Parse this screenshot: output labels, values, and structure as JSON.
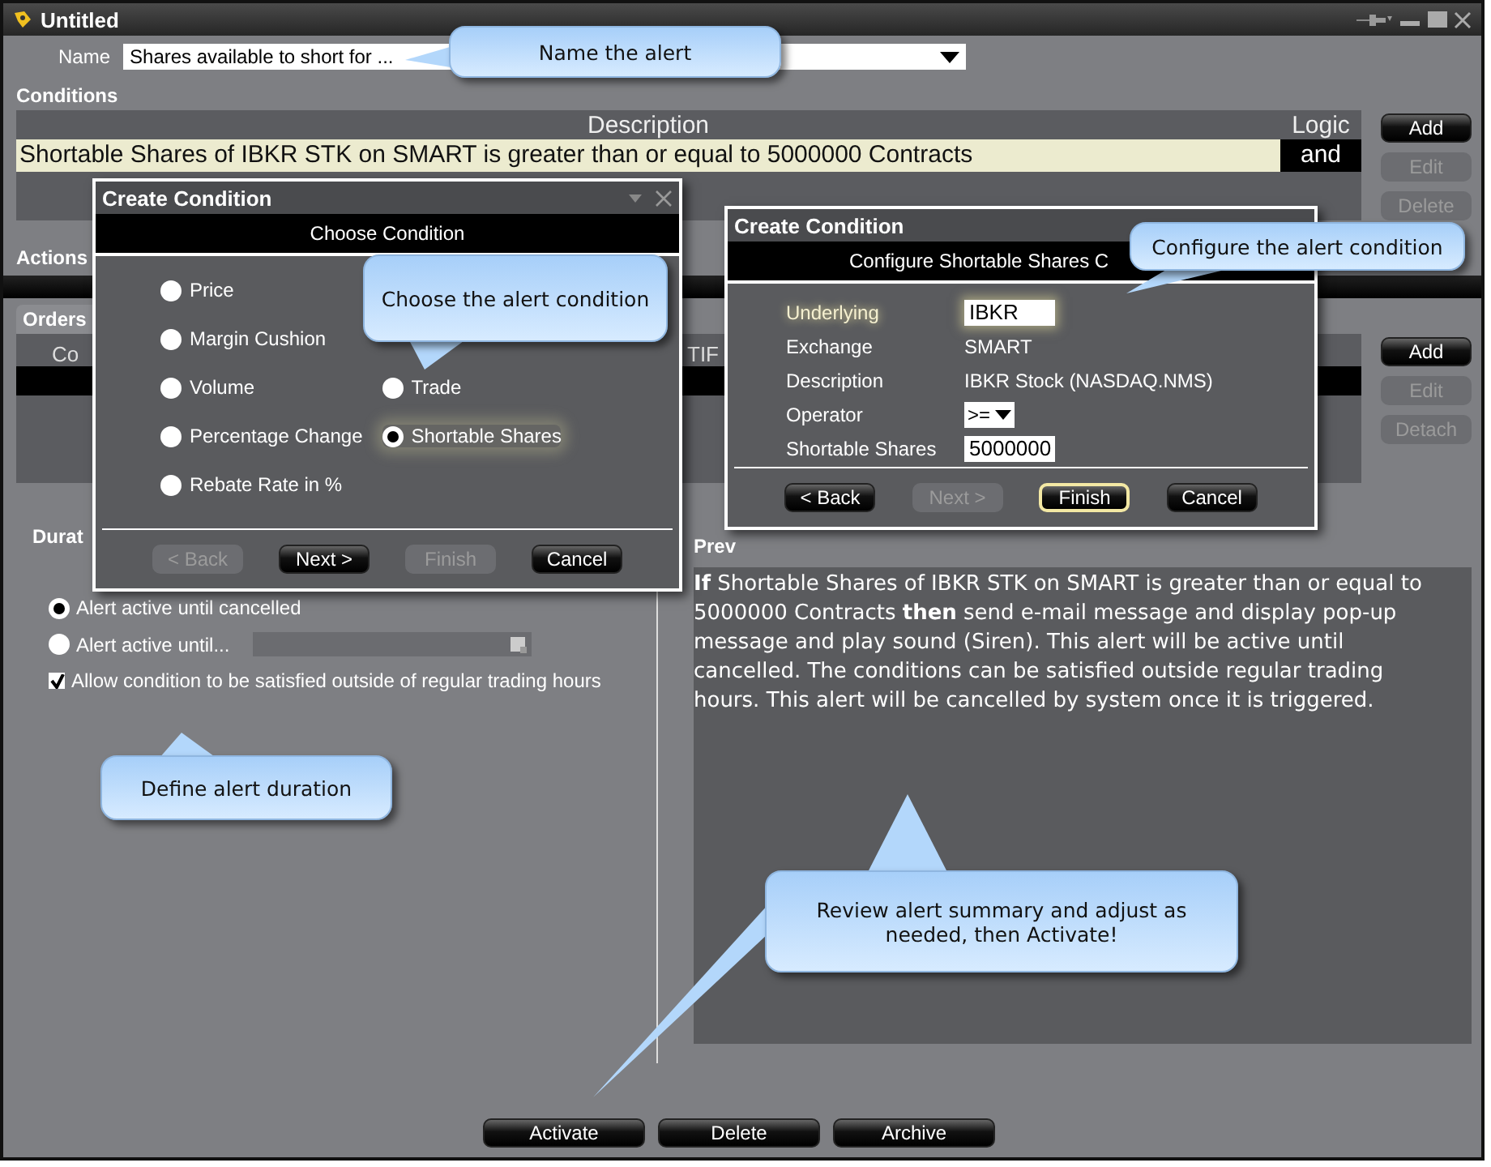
{
  "window": {
    "title": "Untitled"
  },
  "name_field": {
    "label": "Name",
    "value": "Shares available to short for ..."
  },
  "conditions": {
    "title": "Conditions",
    "columns": [
      "Description",
      "Logic"
    ],
    "rows": [
      {
        "description": "Shortable Shares  of IBKR STK on SMART is greater than or equal to 5000000 Contracts",
        "logic": "and"
      }
    ],
    "buttons": [
      {
        "label": "Add",
        "disabled": false
      },
      {
        "label": "Edit",
        "disabled": true
      },
      {
        "label": "Delete",
        "disabled": true
      }
    ]
  },
  "actions": {
    "title": "Actions"
  },
  "orders": {
    "tab": "Orders",
    "columns": [
      "Co",
      "TIF"
    ],
    "buttons": [
      {
        "label": "Add",
        "disabled": false
      },
      {
        "label": "Edit",
        "disabled": true
      },
      {
        "label": "Detach",
        "disabled": true
      }
    ]
  },
  "duration": {
    "title": "Durat",
    "options": [
      {
        "kind": "radio",
        "label": "Alert active until cancelled",
        "checked": true
      },
      {
        "kind": "radio-date",
        "label": "Alert active until...",
        "checked": false
      },
      {
        "kind": "checkbox",
        "label": "Allow condition to be satisfied outside of regular trading hours",
        "checked": true
      }
    ]
  },
  "preview": {
    "title": "Prev",
    "text": "**If** Shortable Shares of IBKR STK on SMART is greater than or equal to 5000000 Contracts **then** send e-mail message and display pop-up message and play sound (Siren). This alert will be active until cancelled. The conditions can be satisfied outside regular trading hours. This alert will be cancelled by system once it is triggered."
  },
  "footer_buttons": [
    "Activate",
    "Delete",
    "Archive"
  ],
  "choose_dialog": {
    "title": "Create Condition",
    "subtitle": "Choose Condition",
    "left_options": [
      {
        "label": "Price",
        "selected": false
      },
      {
        "label": "Margin Cushion",
        "selected": false
      },
      {
        "label": "Volume",
        "selected": false
      },
      {
        "label": "Percentage Change",
        "selected": false
      },
      {
        "label": "Rebate Rate in %",
        "selected": false
      }
    ],
    "right_options": [
      {
        "label": "Trade",
        "selected": false
      },
      {
        "label": "Shortable Shares",
        "selected": true
      }
    ],
    "buttons": [
      {
        "label": "< Back",
        "disabled": true,
        "focused": false
      },
      {
        "label": "Next >",
        "disabled": false,
        "focused": false
      },
      {
        "label": "Finish",
        "disabled": true,
        "focused": false
      },
      {
        "label": "Cancel",
        "disabled": false,
        "focused": false
      }
    ]
  },
  "configure_dialog": {
    "title": "Create Condition",
    "subtitle": "Configure Shortable Shares  C",
    "fields": [
      {
        "label": "Underlying",
        "kind": "input",
        "value": "IBKR",
        "focused": true
      },
      {
        "label": "Exchange",
        "kind": "text",
        "value": "SMART",
        "focused": false
      },
      {
        "label": "Description",
        "kind": "text",
        "value": "IBKR Stock (NASDAQ.NMS)",
        "focused": false
      },
      {
        "label": "Operator",
        "kind": "select",
        "value": ">=",
        "focused": false
      },
      {
        "label": "Shortable Shares",
        "kind": "input",
        "value": "5000000",
        "focused": false
      }
    ],
    "buttons": [
      {
        "label": "< Back",
        "disabled": false,
        "focused": false
      },
      {
        "label": "Next >",
        "disabled": true,
        "focused": false
      },
      {
        "label": "Finish",
        "disabled": false,
        "focused": true
      },
      {
        "label": "Cancel",
        "disabled": false,
        "focused": false
      }
    ]
  },
  "callouts": [
    "Name the alert",
    "Configure the alert condition",
    "Choose the alert condition",
    "Define alert duration",
    "Review alert summary and adjust as needed, then Activate!"
  ]
}
